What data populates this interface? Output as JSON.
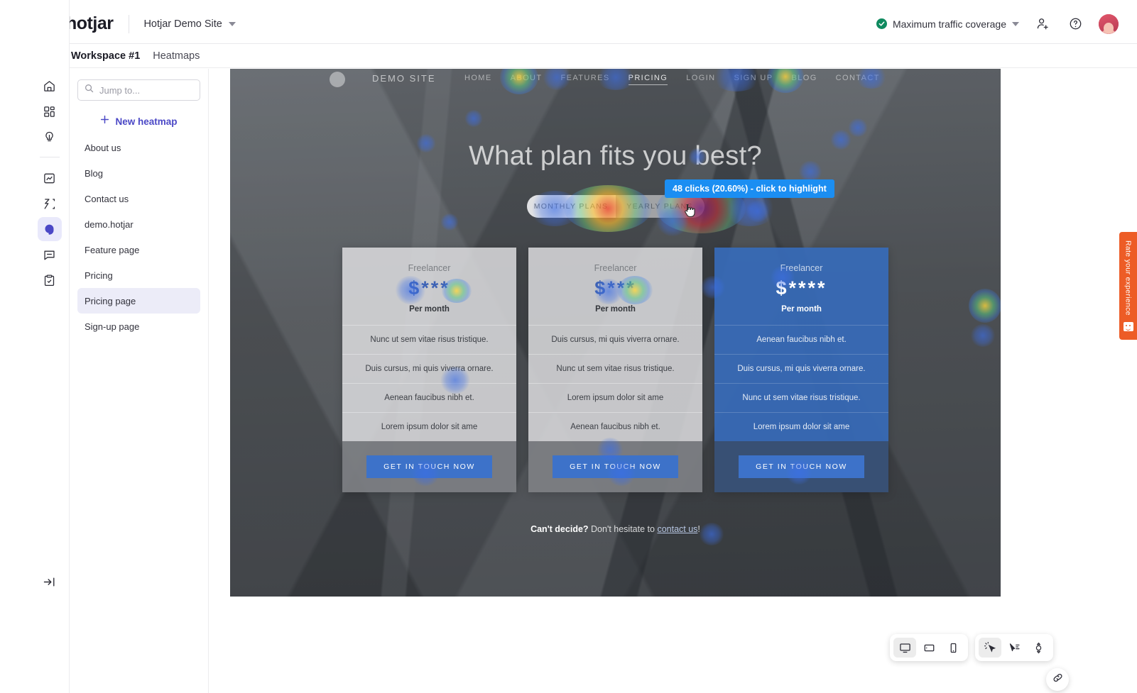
{
  "topbar": {
    "brand_name": "hotjar",
    "site_name": "Hotjar Demo Site",
    "coverage_label": "Maximum traffic coverage",
    "invite_icon": "add-user-icon",
    "help_icon": "help-circle-icon",
    "avatar_icon": "user-avatar"
  },
  "breadcrumb": {
    "back_icon": "arrow-left-icon",
    "workspace": "Workspace #1",
    "section": "Heatmaps"
  },
  "rail": {
    "items": [
      {
        "name": "home-icon"
      },
      {
        "name": "dashboard-icon"
      },
      {
        "name": "insights-bulb-icon"
      },
      {
        "name": "trends-chart-icon"
      },
      {
        "name": "recordings-icon"
      },
      {
        "name": "heatmaps-icon"
      },
      {
        "name": "feedback-icon"
      },
      {
        "name": "surveys-icon"
      }
    ],
    "collapse_icon": "expand-panel-icon"
  },
  "sidebar": {
    "search_placeholder": "Jump to...",
    "search_value": "",
    "new_heatmap_label": "New heatmap",
    "items": [
      {
        "label": "About us",
        "active": false
      },
      {
        "label": "Blog",
        "active": false
      },
      {
        "label": "Contact us",
        "active": false
      },
      {
        "label": "demo.hotjar",
        "active": false
      },
      {
        "label": "Feature page",
        "active": false
      },
      {
        "label": "Pricing",
        "active": false
      },
      {
        "label": "Pricing page",
        "active": true
      },
      {
        "label": "Sign-up page",
        "active": false
      }
    ]
  },
  "page_preview": {
    "brand": "DEMO SITE",
    "nav": [
      {
        "label": "HOME",
        "active": false
      },
      {
        "label": "ABOUT",
        "active": false
      },
      {
        "label": "FEATURES",
        "active": false
      },
      {
        "label": "PRICING",
        "active": true
      },
      {
        "label": "LOGIN",
        "active": false
      },
      {
        "label": "SIGN UP",
        "active": false
      },
      {
        "label": "BLOG",
        "active": false
      },
      {
        "label": "CONTACT",
        "active": false
      }
    ],
    "hero_title": "What plan fits you best?",
    "plan_toggle": [
      {
        "label": "MONTHLY PLANS",
        "selected": true
      },
      {
        "label": "YEARLY PLANS",
        "selected": false
      }
    ],
    "cards": [
      {
        "tier": "Freelancer",
        "price": "$***",
        "period": "Per month",
        "features": [
          "Nunc ut sem vitae risus tristique.",
          "Duis cursus, mi quis viverra ornare.",
          "Aenean faucibus nibh et.",
          "Lorem ipsum dolor sit ame"
        ],
        "cta": "GET IN TOUCH NOW",
        "featured": false
      },
      {
        "tier": "Freelancer",
        "price": "$***",
        "period": "Per month",
        "features": [
          "Duis cursus, mi quis viverra ornare.",
          "Nunc ut sem vitae risus tristique.",
          "Lorem ipsum dolor sit ame",
          "Aenean faucibus nibh et."
        ],
        "cta": "GET IN TOUCH NOW",
        "featured": false
      },
      {
        "tier": "Freelancer",
        "price": "$****",
        "period": "Per month",
        "features": [
          "Aenean faucibus nibh et.",
          "Duis cursus, mi quis viverra ornare.",
          "Nunc ut sem vitae risus tristique.",
          "Lorem ipsum dolor sit ame"
        ],
        "cta": "GET IN TOUCH NOW",
        "featured": true
      }
    ],
    "footer_bold": "Can't decide?",
    "footer_text": " Don't hesitate to ",
    "footer_link": "contact us",
    "footer_tail": "!"
  },
  "tooltip": {
    "text": "48 clicks (20.60%) - click to highlight",
    "clicks": 48,
    "percent": "20.60%",
    "accent": "#1b8ef2"
  },
  "toolbar": {
    "devices": [
      {
        "name": "desktop-icon",
        "on": true
      },
      {
        "name": "tablet-icon",
        "on": false
      },
      {
        "name": "mobile-icon",
        "on": false
      }
    ],
    "modes": [
      {
        "name": "click-map-icon",
        "on": true
      },
      {
        "name": "move-map-icon",
        "on": false
      },
      {
        "name": "scroll-map-icon",
        "on": false
      }
    ],
    "share_icon": "link-icon"
  },
  "rate_tab": {
    "label": "Rate your experience",
    "icon": "smiley-icon",
    "color": "#ed5c26"
  },
  "colors": {
    "accent_purple": "#4b48c6",
    "tooltip_blue": "#1b8ef2",
    "orange": "#ed5c26",
    "success_green": "#0f8a5f"
  }
}
